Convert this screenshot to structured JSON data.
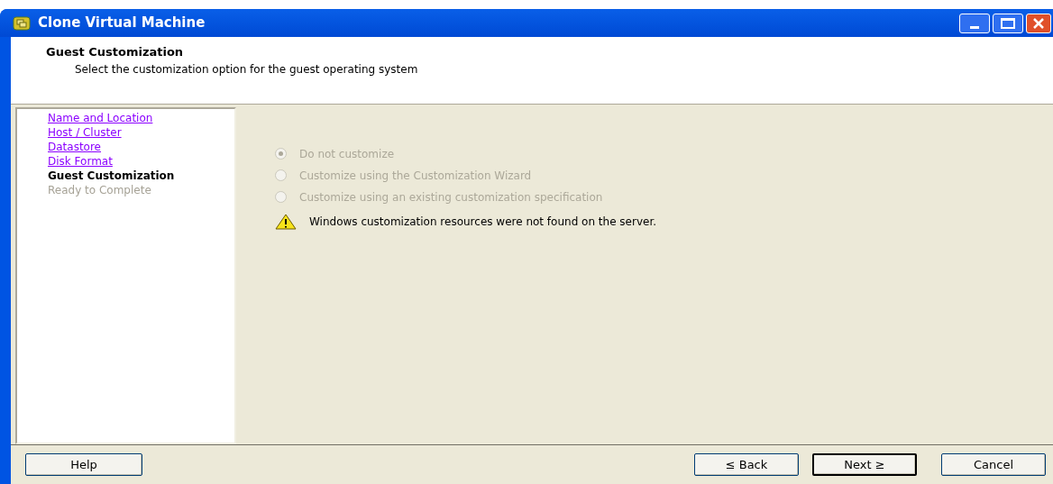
{
  "window": {
    "title": "Clone Virtual Machine"
  },
  "header": {
    "title": "Guest Customization",
    "subtitle": "Select the customization option for the guest operating system"
  },
  "steps": [
    {
      "label": "Name and Location",
      "kind": "link"
    },
    {
      "label": "Host / Cluster",
      "kind": "link"
    },
    {
      "label": "Datastore",
      "kind": "link"
    },
    {
      "label": "Disk Format",
      "kind": "link"
    },
    {
      "label": "Guest Customization",
      "kind": "current"
    },
    {
      "label": "Ready to Complete",
      "kind": "pending"
    }
  ],
  "options": [
    {
      "label": "Do not customize",
      "selected": true,
      "disabled": true
    },
    {
      "label": "Customize using the Customization Wizard",
      "selected": false,
      "disabled": true
    },
    {
      "label": "Customize using an existing customization specification",
      "selected": false,
      "disabled": true
    }
  ],
  "warning": "Windows customization resources were not found on the server.",
  "buttons": {
    "help": "Help",
    "back": "≤ Back",
    "next": "Next ≥",
    "cancel": "Cancel"
  }
}
